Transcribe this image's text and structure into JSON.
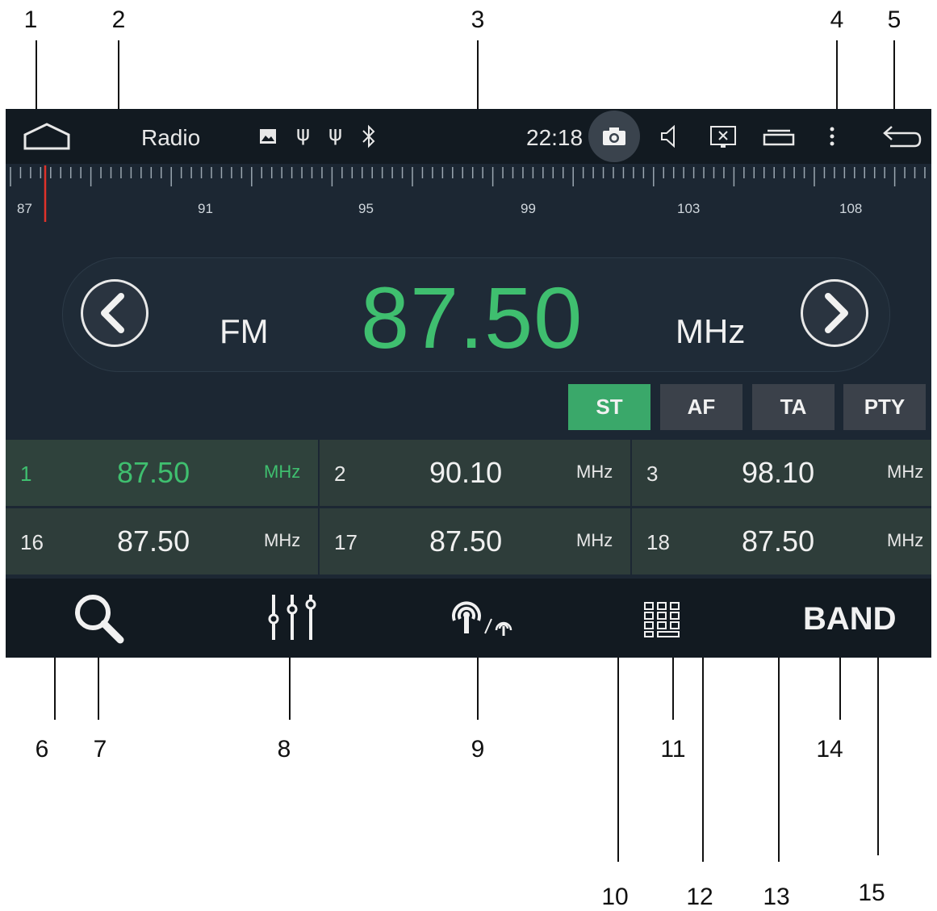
{
  "callouts": {
    "c1": "1",
    "c2": "2",
    "c3": "3",
    "c4": "4",
    "c5": "5",
    "c6": "6",
    "c7": "7",
    "c8": "8",
    "c9": "9",
    "c10": "10",
    "c11": "11",
    "c12": "12",
    "c13": "13",
    "c14": "14",
    "c15": "15"
  },
  "status_bar": {
    "app_title": "Radio",
    "clock": "22:18",
    "icons": [
      "home-icon",
      "image-icon",
      "usb-icon",
      "usb-icon",
      "bluetooth-icon",
      "camera-icon",
      "volume-icon",
      "screen-off-icon",
      "recent-apps-icon",
      "more-icon",
      "back-icon"
    ]
  },
  "dial": {
    "labels": [
      "87",
      "91",
      "95",
      "99",
      "103",
      "108"
    ],
    "current_marker": 87.5
  },
  "tuner": {
    "band": "FM",
    "frequency": "87.50",
    "unit": "MHz"
  },
  "rds": {
    "st": "ST",
    "af": "AF",
    "ta": "TA",
    "pty": "PTY",
    "active": "ST",
    "active_color": "#3aa86a"
  },
  "presets": [
    {
      "num": "1",
      "freq": "87.50",
      "unit": "MHz",
      "active": true
    },
    {
      "num": "2",
      "freq": "90.10",
      "unit": "MHz"
    },
    {
      "num": "3",
      "freq": "98.10",
      "unit": "MHz"
    },
    {
      "num": "16",
      "freq": "87.50",
      "unit": "MHz"
    },
    {
      "num": "17",
      "freq": "87.50",
      "unit": "MHz"
    },
    {
      "num": "18",
      "freq": "87.50",
      "unit": "MHz"
    }
  ],
  "bottom_bar": {
    "band_label": "BAND",
    "icons": [
      "search-icon",
      "equalizer-icon",
      "antenna-icon",
      "keypad-icon"
    ]
  },
  "colors": {
    "accent": "#3fbf6f",
    "background": "#1c2733",
    "bar": "#121a21"
  }
}
